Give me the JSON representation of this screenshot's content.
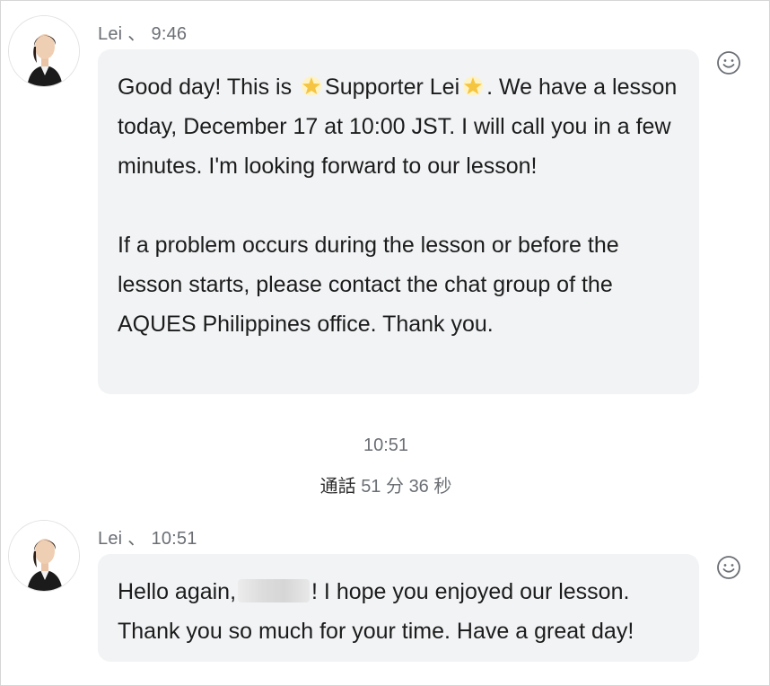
{
  "messages": [
    {
      "sender": "Lei",
      "separator": "、",
      "time": "9:46",
      "paragraphs": [
        {
          "before_star1": "Good day! This is ",
          "between_stars": "Supporter Lei",
          "after_star2": ". We have a lesson today, December 17 at 10:00 JST. I will call you in a few minutes. I'm looking forward to our lesson!"
        },
        "If a problem occurs during the lesson or before the lesson starts, please contact the chat group of the AQUES Philippines office. Thank you."
      ],
      "icons": {
        "star": "star-emoji-icon",
        "reaction": "smiley-reaction-icon"
      }
    },
    {
      "sender": "Lei",
      "separator": "、",
      "time": "10:51",
      "line_before_redaction": "Hello again,",
      "line_after_redaction": "! I hope you enjoyed our lesson. Thank you so much for your time. Have a great day!",
      "icons": {
        "reaction": "smiley-reaction-icon"
      }
    }
  ],
  "call_event": {
    "time": "10:51",
    "label": "通話",
    "minutes": "51",
    "minutes_unit": "分",
    "seconds": "36",
    "seconds_unit": "秒"
  },
  "colors": {
    "bubble_bg": "#f1f3f5",
    "meta_text": "#6b6f74",
    "star": "#f5c542",
    "suit": "#1b1b1b"
  }
}
